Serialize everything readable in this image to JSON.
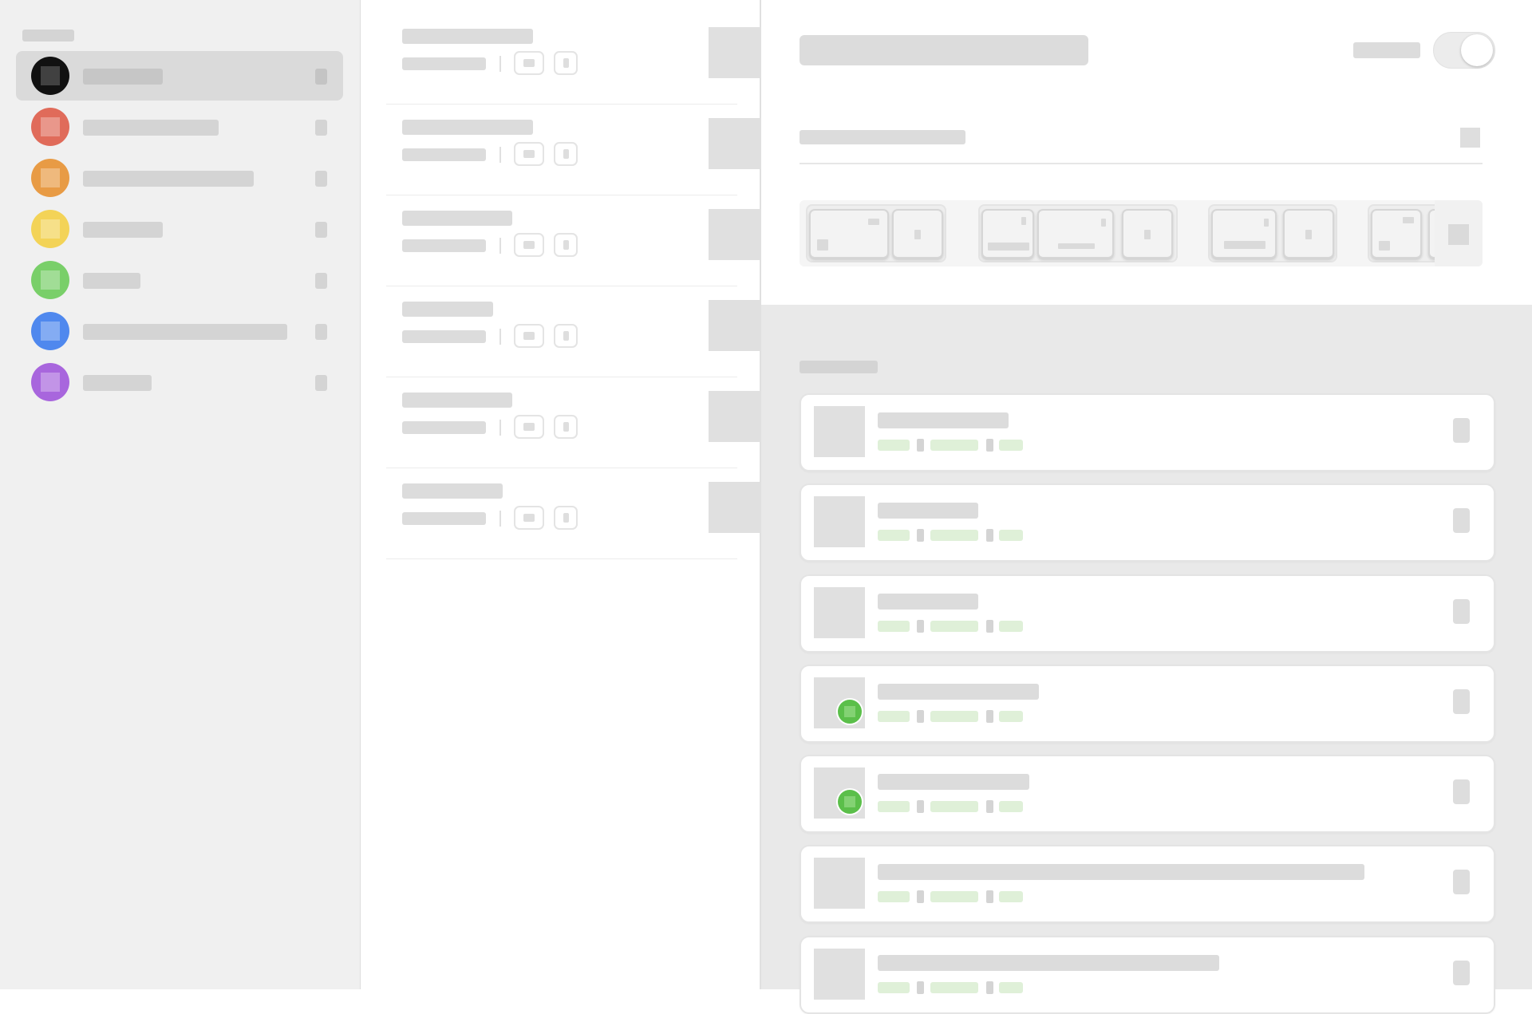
{
  "colors": {
    "accent_black": "#111111",
    "tag_red": "#e06b5a",
    "tag_orange": "#e89b45",
    "tag_yellow": "#f3d357",
    "tag_green": "#79cf69",
    "tag_blue": "#4f88ee",
    "tag_purple": "#a866dd",
    "badge_green": "#5bbf4a",
    "meta_green": "#dff0d8"
  },
  "sidebar": {
    "items": [
      {
        "icon": "black-circle-icon",
        "color": "#111111",
        "selected": true
      },
      {
        "icon": "red-circle-icon",
        "color": "#e06b5a",
        "selected": false
      },
      {
        "icon": "orange-circle-icon",
        "color": "#e89b45",
        "selected": false
      },
      {
        "icon": "yellow-circle-icon",
        "color": "#f3d357",
        "selected": false
      },
      {
        "icon": "green-circle-icon",
        "color": "#79cf69",
        "selected": false
      },
      {
        "icon": "blue-circle-icon",
        "color": "#4f88ee",
        "selected": false
      },
      {
        "icon": "purple-circle-icon",
        "color": "#a866dd",
        "selected": false
      }
    ]
  },
  "list": {
    "rows": [
      {
        "icon": "image-thumbnail-icon"
      },
      {
        "icon": "image-thumbnail-icon"
      },
      {
        "icon": "image-thumbnail-icon"
      },
      {
        "icon": "image-thumbnail-icon"
      },
      {
        "icon": "image-thumbnail-icon"
      },
      {
        "icon": "image-thumbnail-icon"
      }
    ]
  },
  "detail": {
    "toggle_on": false,
    "cards": [
      {
        "badge": false
      },
      {
        "badge": false
      },
      {
        "badge": false
      },
      {
        "badge": true
      },
      {
        "badge": true
      },
      {
        "badge": false
      },
      {
        "badge": false
      }
    ]
  }
}
